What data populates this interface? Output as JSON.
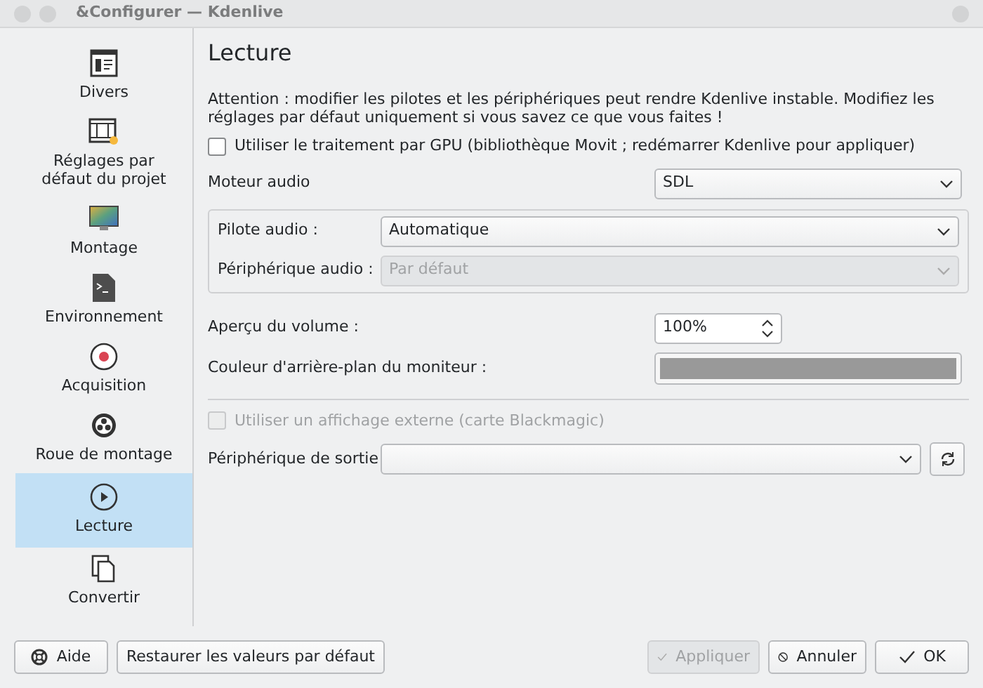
{
  "window": {
    "title": "&Configurer — Kdenlive"
  },
  "sidebar": {
    "items": [
      {
        "label": "Divers",
        "kind": "general",
        "selected": false
      },
      {
        "label": "Réglages par défaut du projet",
        "kind": "film",
        "selected": false
      },
      {
        "label": "Montage",
        "kind": "monitor",
        "selected": false
      },
      {
        "label": "Environnement",
        "kind": "terminal",
        "selected": false
      },
      {
        "label": "Acquisition",
        "kind": "record",
        "selected": false
      },
      {
        "label": "Roue de montage",
        "kind": "wheel",
        "selected": false
      },
      {
        "label": "Lecture",
        "kind": "play",
        "selected": true
      },
      {
        "label": "Convertir",
        "kind": "copy",
        "selected": false
      }
    ]
  },
  "page": {
    "title": "Lecture",
    "warning": "Attention : modifier les pilotes et les périphériques peut rendre Kdenlive instable. Modifiez les réglages par défaut uniquement si vous savez ce que vous faites !",
    "gpu_checkbox": {
      "label": "Utiliser le traitement par GPU (bibliothèque Movit ; redémarrer Kdenlive pour appliquer)",
      "checked": false,
      "disabled": false
    },
    "audio_backend": {
      "label": "Moteur audio",
      "value": "SDL"
    },
    "audio_group": {
      "rows": [
        {
          "label": "Pilote audio :",
          "value": "Automatique",
          "disabled": false
        },
        {
          "label": "Périphérique audio :",
          "value": "Par défaut",
          "disabled": true
        }
      ]
    },
    "volume": {
      "label": "Aperçu du volume :",
      "value": "100%"
    },
    "monitor_background": {
      "label": "Couleur d'arrière-plan du moniteur :",
      "color": "#999999"
    },
    "external_checkbox": {
      "label": "Utiliser un affichage externe (carte Blackmagic)",
      "checked": false,
      "disabled": true
    },
    "output_device": {
      "label": "Périphérique de sortie"
    }
  },
  "buttons": [
    {
      "label": "Aide",
      "kind": "help",
      "disabled": false
    },
    {
      "label": "Restaurer les valeurs par défaut",
      "kind": "plain",
      "disabled": false
    },
    {
      "label": "Appliquer",
      "kind": "apply",
      "disabled": true
    },
    {
      "label": "Annuler",
      "kind": "cancel",
      "disabled": false
    },
    {
      "label": "OK",
      "kind": "ok",
      "disabled": false
    }
  ]
}
